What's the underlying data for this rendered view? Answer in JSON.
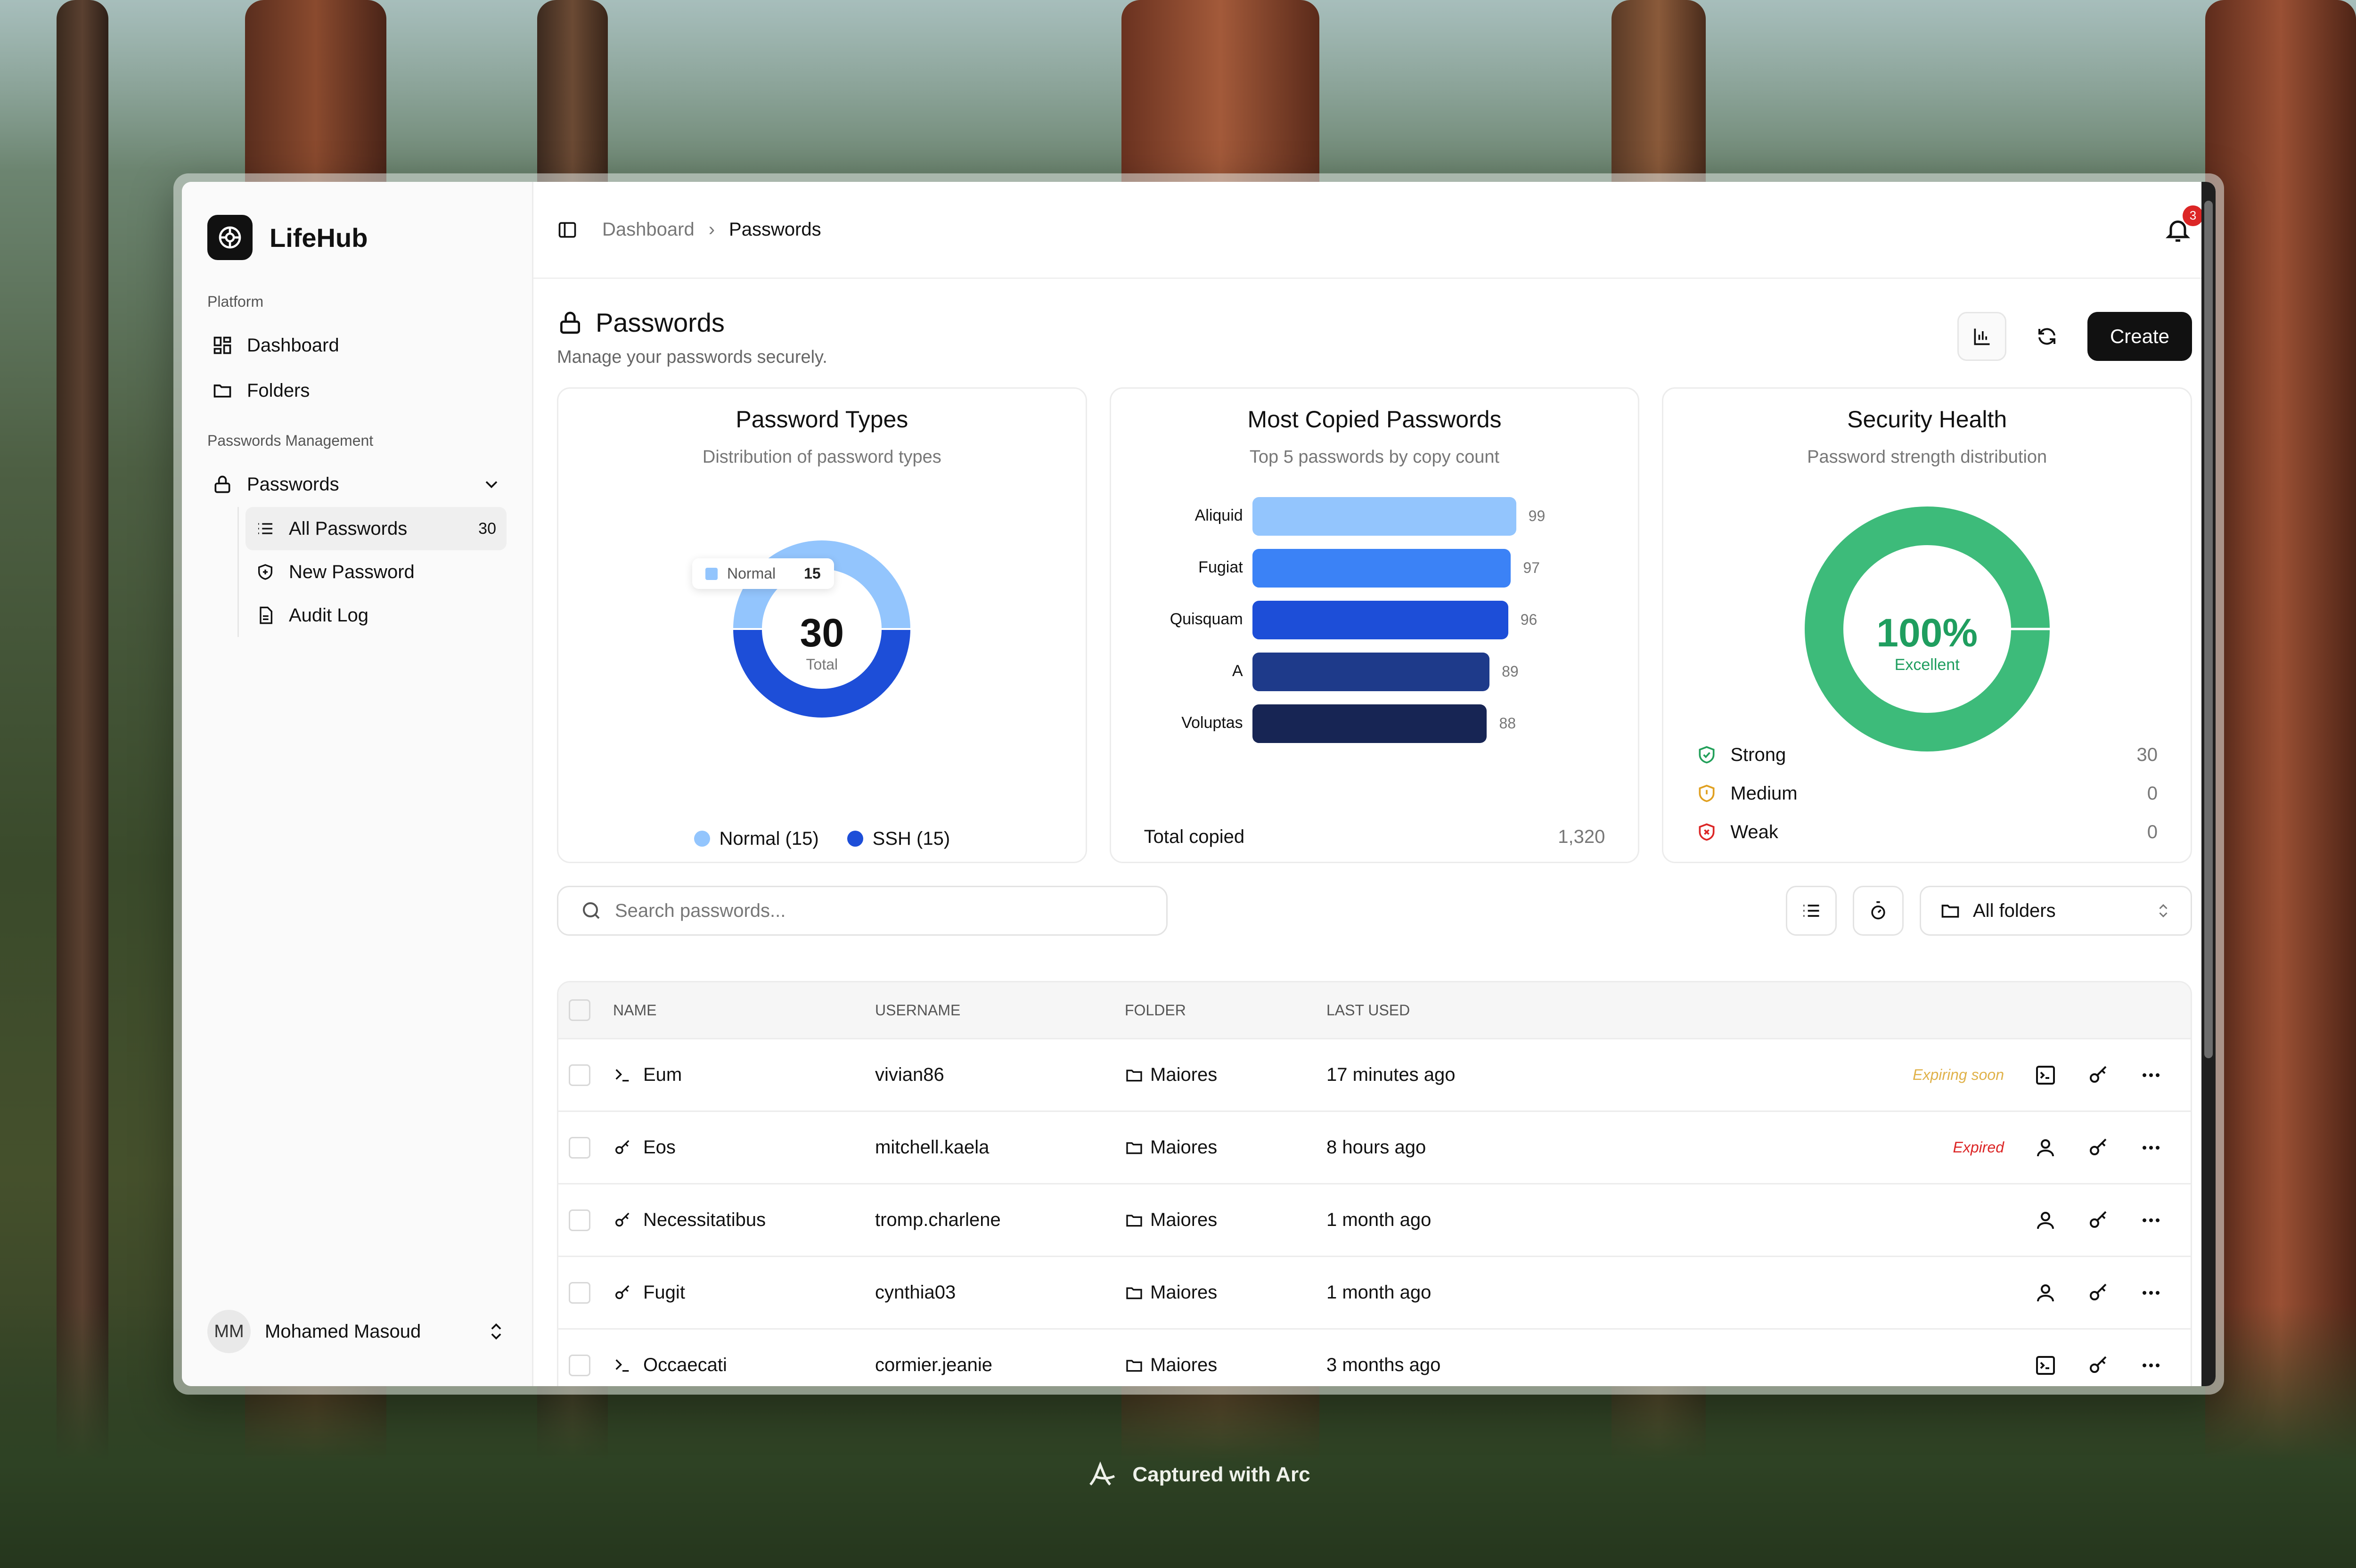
{
  "colors": {
    "accent": "#111111",
    "normal": "#93c5fd",
    "ssh": "#1d4ed8",
    "health": "#3dbb7a",
    "expired": "#dc2626",
    "expiring": "#e0b24a"
  },
  "brand": {
    "name": "LifeHub",
    "icon": "lifehub-logo-icon"
  },
  "sidebar": {
    "platform_label": "Platform",
    "platform_items": [
      {
        "label": "Dashboard",
        "icon": "dashboard-icon"
      },
      {
        "label": "Folders",
        "icon": "folder-icon"
      }
    ],
    "management_label": "Passwords Management",
    "passwords_label": "Passwords",
    "sub_items": [
      {
        "label": "All Passwords",
        "count": "30",
        "icon": "list-icon"
      },
      {
        "label": "New Password",
        "icon": "shield-plus-icon"
      },
      {
        "label": "Audit Log",
        "icon": "document-icon"
      }
    ],
    "user": {
      "initials": "MM",
      "name": "Mohamed Masoud"
    }
  },
  "topbar": {
    "crumb_root": "Dashboard",
    "crumb_current": "Passwords",
    "notifications": "3"
  },
  "page": {
    "title": "Passwords",
    "subtitle": "Manage your passwords securely.",
    "create_label": "Create"
  },
  "cards": {
    "types": {
      "title": "Password Types",
      "subtitle": "Distribution of password types",
      "total": "30",
      "total_label": "Total",
      "tooltip_label": "Normal",
      "tooltip_value": "15",
      "legend_normal": "Normal (15)",
      "legend_ssh": "SSH (15)"
    },
    "copied": {
      "title": "Most Copied Passwords",
      "subtitle": "Top 5 passwords by copy count",
      "total_label": "Total copied",
      "total_value": "1,320"
    },
    "health": {
      "title": "Security Health",
      "subtitle": "Password strength distribution",
      "percent": "100%",
      "rating": "Excellent",
      "items": [
        {
          "label": "Strong",
          "value": "30"
        },
        {
          "label": "Medium",
          "value": "0"
        },
        {
          "label": "Weak",
          "value": "0"
        }
      ]
    }
  },
  "chart_data": [
    {
      "type": "pie",
      "categories": [
        "Normal",
        "SSH"
      ],
      "values": [
        15,
        15
      ],
      "title": "Password Types"
    },
    {
      "type": "bar",
      "orientation": "horizontal",
      "categories": [
        "Aliquid",
        "Fugiat",
        "Quisquam",
        "A",
        "Voluptas"
      ],
      "values": [
        99,
        97,
        96,
        89,
        88
      ],
      "title": "Most Copied Passwords",
      "colors": [
        "#93c5fd",
        "#3b82f6",
        "#1d4ed8",
        "#1e3a8a",
        "#172554"
      ]
    },
    {
      "type": "pie",
      "categories": [
        "Strong",
        "Medium",
        "Weak"
      ],
      "values": [
        30,
        0,
        0
      ],
      "title": "Security Health"
    }
  ],
  "toolbar": {
    "search_placeholder": "Search passwords...",
    "folder_select": "All folders"
  },
  "table": {
    "headers": {
      "name": "NAME",
      "username": "USERNAME",
      "folder": "FOLDER",
      "last_used": "LAST USED"
    },
    "rows": [
      {
        "name": "Eum",
        "type": "ssh",
        "username": "vivian86",
        "folder": "Maiores",
        "last_used": "17 minutes ago",
        "status": "Expiring soon"
      },
      {
        "name": "Eos",
        "type": "normal",
        "username": "mitchell.kaela",
        "folder": "Maiores",
        "last_used": "8 hours ago",
        "status": "Expired"
      },
      {
        "name": "Necessitatibus",
        "type": "normal",
        "username": "tromp.charlene",
        "folder": "Maiores",
        "last_used": "1 month ago",
        "status": ""
      },
      {
        "name": "Fugit",
        "type": "normal",
        "username": "cynthia03",
        "folder": "Maiores",
        "last_used": "1 month ago",
        "status": ""
      },
      {
        "name": "Occaecati",
        "type": "ssh",
        "username": "cormier.jeanie",
        "folder": "Maiores",
        "last_used": "3 months ago",
        "status": ""
      }
    ]
  },
  "caption": "Captured with Arc"
}
